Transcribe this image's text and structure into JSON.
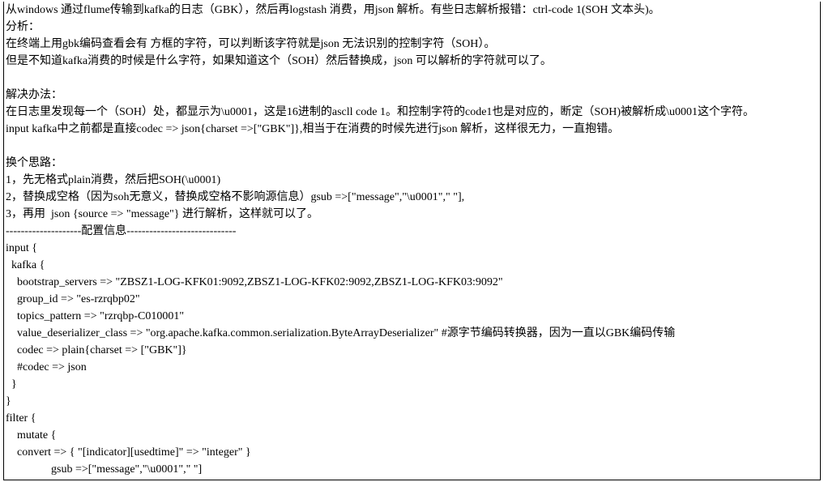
{
  "lines": [
    {
      "cls": "",
      "text": "从windows 通过flume传输到kafka的日志（GBK），然后再logstash 消费，用json 解析。有些日志解析报错：ctrl-code 1(SOH 文本头)。"
    },
    {
      "cls": "",
      "text": "分析："
    },
    {
      "cls": "",
      "text": "在终端上用gbk编码查看会有 方框的字符，可以判断该字符就是json 无法识别的控制字符（SOH）。"
    },
    {
      "cls": "",
      "text": "但是不知道kafka消费的时候是什么字符，如果知道这个（SOH）然后替换成，json 可以解析的字符就可以了。"
    },
    {
      "cls": "",
      "text": " "
    },
    {
      "cls": "",
      "text": "解决办法："
    },
    {
      "cls": "",
      "text": "在日志里发现每一个（SOH）处，都显示为\\u0001，这是16进制的ascll code 1。和控制字符的code1也是对应的，断定（SOH)被解析成\\u0001这个字符。"
    },
    {
      "cls": "",
      "text": "input kafka中之前都是直接codec => json{charset =>[\"GBK\"]},相当于在消费的时候先进行json 解析，这样很无力，一直抱错。"
    },
    {
      "cls": "",
      "text": " "
    },
    {
      "cls": "",
      "text": "换个思路："
    },
    {
      "cls": "",
      "text": "1，先无格式plain消费，然后把SOH(\\u0001)"
    },
    {
      "cls": "",
      "text": "2，替换成空格（因为soh无意义，替换成空格不影响源信息）gsub =>[\"message\",\"\\u0001\",\" \"],"
    },
    {
      "cls": "",
      "text": "3，再用  json {source => \"message\"} 进行解析，这样就可以了。"
    },
    {
      "cls": "",
      "text": "--------------------配置信息-----------------------------"
    },
    {
      "cls": "",
      "text": "input {"
    },
    {
      "cls": "indent-1",
      "text": "kafka {"
    },
    {
      "cls": "indent-2",
      "text": "bootstrap_servers => \"ZBSZ1-LOG-KFK01:9092,ZBSZ1-LOG-KFK02:9092,ZBSZ1-LOG-KFK03:9092\""
    },
    {
      "cls": "indent-2",
      "text": "group_id => \"es-rzrqbp02\""
    },
    {
      "cls": "indent-2",
      "text": "topics_pattern => \"rzrqbp-C010001\""
    },
    {
      "cls": "indent-2",
      "text": "value_deserializer_class => \"org.apache.kafka.common.serialization.ByteArrayDeserializer\" #源字节编码转换器，因为一直以GBK编码传输"
    },
    {
      "cls": "indent-2",
      "text": "codec => plain{charset => [\"GBK\"]}"
    },
    {
      "cls": "indent-2",
      "text": "#codec => json"
    },
    {
      "cls": "indent-1",
      "text": "}"
    },
    {
      "cls": "",
      "text": "}"
    },
    {
      "cls": "",
      "text": "filter {"
    },
    {
      "cls": "indent-2",
      "text": "mutate {"
    },
    {
      "cls": "indent-2",
      "text": "convert => { \"[indicator][usedtime]\" => \"integer\" }"
    },
    {
      "cls": "indent-gsub",
      "text": "gsub =>[\"message\",\"\\u0001\",\" \"]"
    }
  ]
}
